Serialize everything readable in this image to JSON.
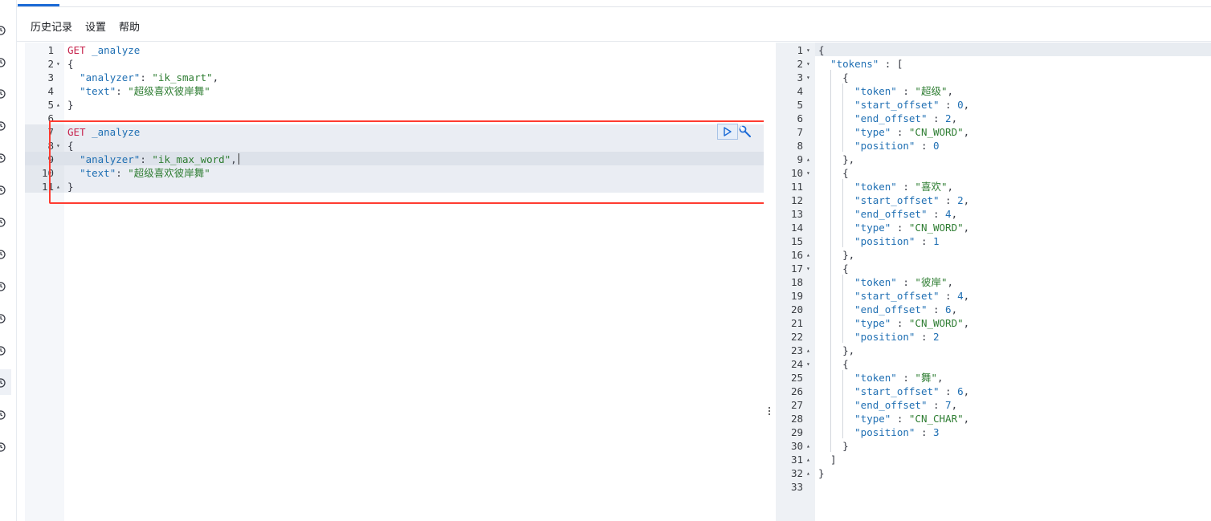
{
  "menu": {
    "history": "历史记录",
    "settings": "设置",
    "help": "帮助"
  },
  "nav_icons": [
    "clock-icon",
    "discover-icon",
    "dashboard-icon",
    "canvas-icon",
    "maps-icon",
    "ml-icon",
    "graph-icon",
    "monitoring-icon",
    "apm-icon",
    "uptime-icon",
    "siem-icon",
    "dev-tools-icon",
    "stack-monitoring-icon",
    "management-icon"
  ],
  "request_editor": {
    "lines": [
      {
        "n": "1",
        "fold": "",
        "tokens": [
          [
            "k-method",
            "GET"
          ],
          [
            "k-path",
            " _analyze"
          ]
        ]
      },
      {
        "n": "2",
        "fold": "▾",
        "tokens": [
          [
            "k-punc",
            "{"
          ]
        ]
      },
      {
        "n": "3",
        "fold": "",
        "tokens": [
          [
            "k-punc",
            "  "
          ],
          [
            "k-key",
            "\"analyzer\""
          ],
          [
            "k-punc",
            ": "
          ],
          [
            "k-str",
            "\"ik_smart\""
          ],
          [
            "k-punc",
            ","
          ]
        ]
      },
      {
        "n": "4",
        "fold": "",
        "tokens": [
          [
            "k-punc",
            "  "
          ],
          [
            "k-key",
            "\"text\""
          ],
          [
            "k-punc",
            ": "
          ],
          [
            "k-str",
            "\"超级喜欢彼岸舞\""
          ]
        ]
      },
      {
        "n": "5",
        "fold": "▴",
        "tokens": [
          [
            "k-punc",
            "}"
          ]
        ]
      },
      {
        "n": "6",
        "fold": "",
        "tokens": []
      },
      {
        "n": "7",
        "fold": "",
        "tokens": [
          [
            "k-method",
            "GET"
          ],
          [
            "k-path",
            " _analyze"
          ]
        ]
      },
      {
        "n": "8",
        "fold": "▾",
        "tokens": [
          [
            "k-punc",
            "{"
          ]
        ]
      },
      {
        "n": "9",
        "fold": "",
        "tokens": [
          [
            "k-punc",
            "  "
          ],
          [
            "k-key",
            "\"analyzer\""
          ],
          [
            "k-punc",
            ": "
          ],
          [
            "k-str",
            "\"ik_max_word\""
          ],
          [
            "k-punc",
            ","
          ]
        ]
      },
      {
        "n": "10",
        "fold": "",
        "tokens": [
          [
            "k-punc",
            "  "
          ],
          [
            "k-key",
            "\"text\""
          ],
          [
            "k-punc",
            ": "
          ],
          [
            "k-str",
            "\"超级喜欢彼岸舞\""
          ]
        ]
      },
      {
        "n": "11",
        "fold": "▴",
        "tokens": [
          [
            "k-punc",
            "}"
          ]
        ]
      }
    ]
  },
  "response_editor": {
    "lines": [
      {
        "n": "1",
        "fold": "▾",
        "tokens": [
          [
            "k-punc",
            "{"
          ]
        ]
      },
      {
        "n": "2",
        "fold": "▾",
        "tokens": [
          [
            "k-punc",
            "  "
          ],
          [
            "k-key",
            "\"tokens\""
          ],
          [
            "k-punc",
            " : ["
          ]
        ]
      },
      {
        "n": "3",
        "fold": "▾",
        "tokens": [
          [
            "k-punc",
            "    {"
          ]
        ]
      },
      {
        "n": "4",
        "fold": "",
        "tokens": [
          [
            "k-punc",
            "      "
          ],
          [
            "k-key",
            "\"token\""
          ],
          [
            "k-punc",
            " : "
          ],
          [
            "k-str",
            "\"超级\""
          ],
          [
            "k-punc",
            ","
          ]
        ]
      },
      {
        "n": "5",
        "fold": "",
        "tokens": [
          [
            "k-punc",
            "      "
          ],
          [
            "k-key",
            "\"start_offset\""
          ],
          [
            "k-punc",
            " : "
          ],
          [
            "k-num",
            "0"
          ],
          [
            "k-punc",
            ","
          ]
        ]
      },
      {
        "n": "6",
        "fold": "",
        "tokens": [
          [
            "k-punc",
            "      "
          ],
          [
            "k-key",
            "\"end_offset\""
          ],
          [
            "k-punc",
            " : "
          ],
          [
            "k-num",
            "2"
          ],
          [
            "k-punc",
            ","
          ]
        ]
      },
      {
        "n": "7",
        "fold": "",
        "tokens": [
          [
            "k-punc",
            "      "
          ],
          [
            "k-key",
            "\"type\""
          ],
          [
            "k-punc",
            " : "
          ],
          [
            "k-str",
            "\"CN_WORD\""
          ],
          [
            "k-punc",
            ","
          ]
        ]
      },
      {
        "n": "8",
        "fold": "",
        "tokens": [
          [
            "k-punc",
            "      "
          ],
          [
            "k-key",
            "\"position\""
          ],
          [
            "k-punc",
            " : "
          ],
          [
            "k-num",
            "0"
          ]
        ]
      },
      {
        "n": "9",
        "fold": "▴",
        "tokens": [
          [
            "k-punc",
            "    },"
          ]
        ]
      },
      {
        "n": "10",
        "fold": "▾",
        "tokens": [
          [
            "k-punc",
            "    {"
          ]
        ]
      },
      {
        "n": "11",
        "fold": "",
        "tokens": [
          [
            "k-punc",
            "      "
          ],
          [
            "k-key",
            "\"token\""
          ],
          [
            "k-punc",
            " : "
          ],
          [
            "k-str",
            "\"喜欢\""
          ],
          [
            "k-punc",
            ","
          ]
        ]
      },
      {
        "n": "12",
        "fold": "",
        "tokens": [
          [
            "k-punc",
            "      "
          ],
          [
            "k-key",
            "\"start_offset\""
          ],
          [
            "k-punc",
            " : "
          ],
          [
            "k-num",
            "2"
          ],
          [
            "k-punc",
            ","
          ]
        ]
      },
      {
        "n": "13",
        "fold": "",
        "tokens": [
          [
            "k-punc",
            "      "
          ],
          [
            "k-key",
            "\"end_offset\""
          ],
          [
            "k-punc",
            " : "
          ],
          [
            "k-num",
            "4"
          ],
          [
            "k-punc",
            ","
          ]
        ]
      },
      {
        "n": "14",
        "fold": "",
        "tokens": [
          [
            "k-punc",
            "      "
          ],
          [
            "k-key",
            "\"type\""
          ],
          [
            "k-punc",
            " : "
          ],
          [
            "k-str",
            "\"CN_WORD\""
          ],
          [
            "k-punc",
            ","
          ]
        ]
      },
      {
        "n": "15",
        "fold": "",
        "tokens": [
          [
            "k-punc",
            "      "
          ],
          [
            "k-key",
            "\"position\""
          ],
          [
            "k-punc",
            " : "
          ],
          [
            "k-num",
            "1"
          ]
        ]
      },
      {
        "n": "16",
        "fold": "▴",
        "tokens": [
          [
            "k-punc",
            "    },"
          ]
        ]
      },
      {
        "n": "17",
        "fold": "▾",
        "tokens": [
          [
            "k-punc",
            "    {"
          ]
        ]
      },
      {
        "n": "18",
        "fold": "",
        "tokens": [
          [
            "k-punc",
            "      "
          ],
          [
            "k-key",
            "\"token\""
          ],
          [
            "k-punc",
            " : "
          ],
          [
            "k-str",
            "\"彼岸\""
          ],
          [
            "k-punc",
            ","
          ]
        ]
      },
      {
        "n": "19",
        "fold": "",
        "tokens": [
          [
            "k-punc",
            "      "
          ],
          [
            "k-key",
            "\"start_offset\""
          ],
          [
            "k-punc",
            " : "
          ],
          [
            "k-num",
            "4"
          ],
          [
            "k-punc",
            ","
          ]
        ]
      },
      {
        "n": "20",
        "fold": "",
        "tokens": [
          [
            "k-punc",
            "      "
          ],
          [
            "k-key",
            "\"end_offset\""
          ],
          [
            "k-punc",
            " : "
          ],
          [
            "k-num",
            "6"
          ],
          [
            "k-punc",
            ","
          ]
        ]
      },
      {
        "n": "21",
        "fold": "",
        "tokens": [
          [
            "k-punc",
            "      "
          ],
          [
            "k-key",
            "\"type\""
          ],
          [
            "k-punc",
            " : "
          ],
          [
            "k-str",
            "\"CN_WORD\""
          ],
          [
            "k-punc",
            ","
          ]
        ]
      },
      {
        "n": "22",
        "fold": "",
        "tokens": [
          [
            "k-punc",
            "      "
          ],
          [
            "k-key",
            "\"position\""
          ],
          [
            "k-punc",
            " : "
          ],
          [
            "k-num",
            "2"
          ]
        ]
      },
      {
        "n": "23",
        "fold": "▴",
        "tokens": [
          [
            "k-punc",
            "    },"
          ]
        ]
      },
      {
        "n": "24",
        "fold": "▾",
        "tokens": [
          [
            "k-punc",
            "    {"
          ]
        ]
      },
      {
        "n": "25",
        "fold": "",
        "tokens": [
          [
            "k-punc",
            "      "
          ],
          [
            "k-key",
            "\"token\""
          ],
          [
            "k-punc",
            " : "
          ],
          [
            "k-str",
            "\"舞\""
          ],
          [
            "k-punc",
            ","
          ]
        ]
      },
      {
        "n": "26",
        "fold": "",
        "tokens": [
          [
            "k-punc",
            "      "
          ],
          [
            "k-key",
            "\"start_offset\""
          ],
          [
            "k-punc",
            " : "
          ],
          [
            "k-num",
            "6"
          ],
          [
            "k-punc",
            ","
          ]
        ]
      },
      {
        "n": "27",
        "fold": "",
        "tokens": [
          [
            "k-punc",
            "      "
          ],
          [
            "k-key",
            "\"end_offset\""
          ],
          [
            "k-punc",
            " : "
          ],
          [
            "k-num",
            "7"
          ],
          [
            "k-punc",
            ","
          ]
        ]
      },
      {
        "n": "28",
        "fold": "",
        "tokens": [
          [
            "k-punc",
            "      "
          ],
          [
            "k-key",
            "\"type\""
          ],
          [
            "k-punc",
            " : "
          ],
          [
            "k-str",
            "\"CN_CHAR\""
          ],
          [
            "k-punc",
            ","
          ]
        ]
      },
      {
        "n": "29",
        "fold": "",
        "tokens": [
          [
            "k-punc",
            "      "
          ],
          [
            "k-key",
            "\"position\""
          ],
          [
            "k-punc",
            " : "
          ],
          [
            "k-num",
            "3"
          ]
        ]
      },
      {
        "n": "30",
        "fold": "▴",
        "tokens": [
          [
            "k-punc",
            "    }"
          ]
        ]
      },
      {
        "n": "31",
        "fold": "▴",
        "tokens": [
          [
            "k-punc",
            "  ]"
          ]
        ]
      },
      {
        "n": "32",
        "fold": "▴",
        "tokens": [
          [
            "k-punc",
            "}"
          ]
        ]
      },
      {
        "n": "33",
        "fold": "",
        "tokens": []
      }
    ]
  },
  "colors": {
    "accent": "#1b6ad6",
    "highlight_box": "#ff3b30",
    "method": "#c7254e",
    "key": "#1f6fb3",
    "string": "#2e7d32"
  }
}
